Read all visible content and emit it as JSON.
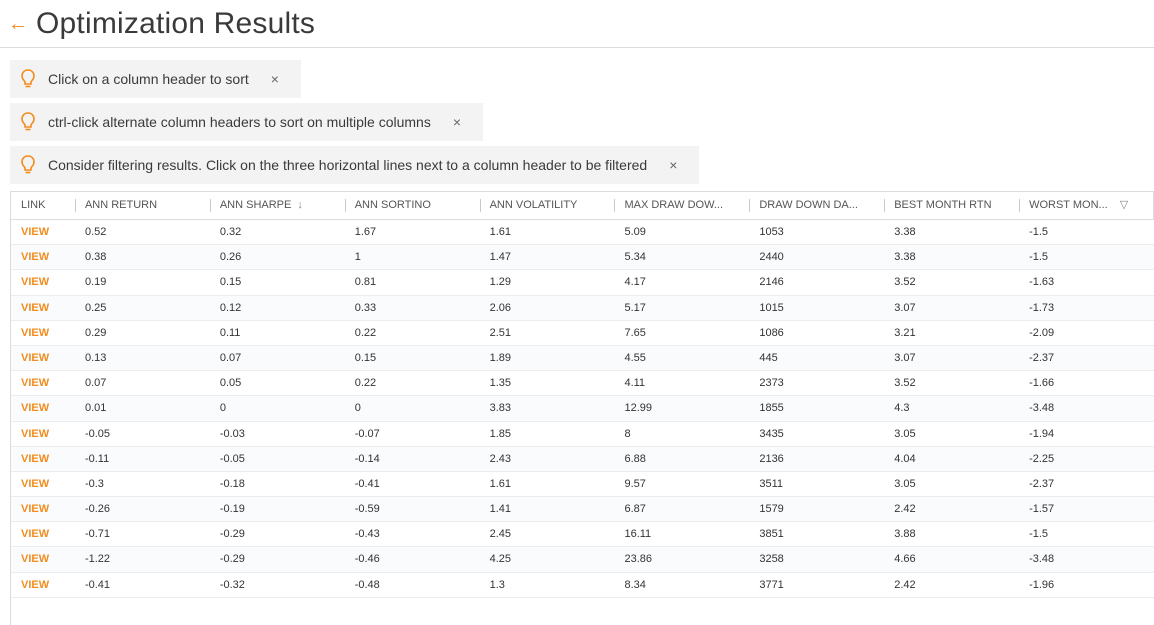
{
  "header": {
    "title": "Optimization Results"
  },
  "tips": [
    {
      "text": "Click on a column header to sort",
      "close": "×"
    },
    {
      "text": "ctrl-click alternate column headers to sort on multiple columns",
      "close": "×"
    },
    {
      "text": "Consider filtering results. Click on the three horizontal lines next to a column header to be filtered",
      "close": "×"
    }
  ],
  "table": {
    "columns": [
      "LINK",
      "ANN RETURN",
      "ANN SHARPE",
      "ANN SORTINO",
      "ANN VOLATILITY",
      "MAX DRAW DOW...",
      "DRAW DOWN DA...",
      "BEST MONTH RTN",
      "WORST MON..."
    ],
    "sort_indicator": "↓",
    "filter_indicator": "▽",
    "link_label": "VIEW",
    "rows": [
      [
        "0.52",
        "0.32",
        "1.67",
        "1.61",
        "5.09",
        "1053",
        "3.38",
        "-1.5"
      ],
      [
        "0.38",
        "0.26",
        "1",
        "1.47",
        "5.34",
        "2440",
        "3.38",
        "-1.5"
      ],
      [
        "0.19",
        "0.15",
        "0.81",
        "1.29",
        "4.17",
        "2146",
        "3.52",
        "-1.63"
      ],
      [
        "0.25",
        "0.12",
        "0.33",
        "2.06",
        "5.17",
        "1015",
        "3.07",
        "-1.73"
      ],
      [
        "0.29",
        "0.11",
        "0.22",
        "2.51",
        "7.65",
        "1086",
        "3.21",
        "-2.09"
      ],
      [
        "0.13",
        "0.07",
        "0.15",
        "1.89",
        "4.55",
        "445",
        "3.07",
        "-2.37"
      ],
      [
        "0.07",
        "0.05",
        "0.22",
        "1.35",
        "4.11",
        "2373",
        "3.52",
        "-1.66"
      ],
      [
        "0.01",
        "0",
        "0",
        "3.83",
        "12.99",
        "1855",
        "4.3",
        "-3.48"
      ],
      [
        "-0.05",
        "-0.03",
        "-0.07",
        "1.85",
        "8",
        "3435",
        "3.05",
        "-1.94"
      ],
      [
        "-0.11",
        "-0.05",
        "-0.14",
        "2.43",
        "6.88",
        "2136",
        "4.04",
        "-2.25"
      ],
      [
        "-0.3",
        "-0.18",
        "-0.41",
        "1.61",
        "9.57",
        "3511",
        "3.05",
        "-2.37"
      ],
      [
        "-0.26",
        "-0.19",
        "-0.59",
        "1.41",
        "6.87",
        "1579",
        "2.42",
        "-1.57"
      ],
      [
        "-0.71",
        "-0.29",
        "-0.43",
        "2.45",
        "16.11",
        "3851",
        "3.88",
        "-1.5"
      ],
      [
        "-1.22",
        "-0.29",
        "-0.46",
        "4.25",
        "23.86",
        "3258",
        "4.66",
        "-3.48"
      ],
      [
        "-0.41",
        "-0.32",
        "-0.48",
        "1.3",
        "8.34",
        "3771",
        "2.42",
        "-1.96"
      ]
    ]
  },
  "colors": {
    "accent": "#f28c1f"
  }
}
